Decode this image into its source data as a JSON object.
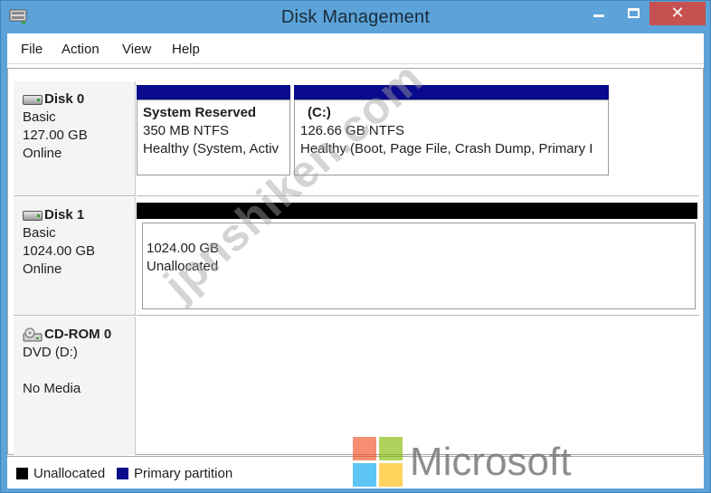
{
  "window": {
    "title": "Disk Management",
    "controls": {
      "minimize": "minimize",
      "maximize": "maximize",
      "close": "✕"
    }
  },
  "menu": [
    "File",
    "Action",
    "View",
    "Help"
  ],
  "disks": [
    {
      "name": "Disk 0",
      "type": "Basic",
      "size": "127.00 GB",
      "status": "Online",
      "icon": "hard-disk-icon",
      "partitions": [
        {
          "name": "System Reserved",
          "size": "350 MB NTFS",
          "status": "Healthy (System, Activ"
        },
        {
          "name": "(C:)",
          "size": "126.66 GB NTFS",
          "status": "Healthy (Boot, Page File, Crash Dump, Primary I"
        }
      ]
    },
    {
      "name": "Disk 1",
      "type": "Basic",
      "size": "1024.00 GB",
      "status": "Online",
      "icon": "hard-disk-icon",
      "partitions": [
        {
          "name": "",
          "size": "1024.00 GB",
          "status": "Unallocated"
        }
      ]
    },
    {
      "name": "CD-ROM 0",
      "type": "DVD (D:)",
      "size": "",
      "status": "No Media",
      "icon": "cd-rom-icon"
    }
  ],
  "legend": [
    {
      "label": "Unallocated",
      "color": "#000000"
    },
    {
      "label": "Primary partition",
      "color": "#0a0a8c"
    }
  ],
  "watermark": "jpnshiken.com",
  "brand": {
    "name": "Microsoft",
    "colors": [
      "#f25022",
      "#7fba00",
      "#00a4ef",
      "#ffb900"
    ]
  }
}
